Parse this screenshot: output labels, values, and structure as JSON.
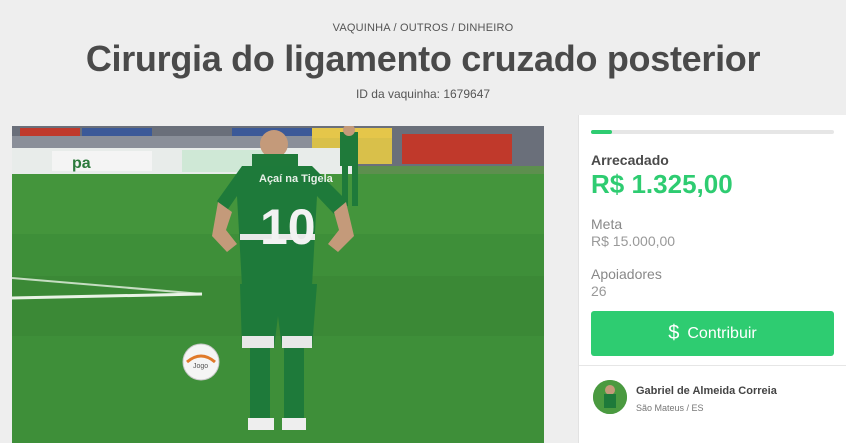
{
  "breadcrumb": "VAQUINHA / OUTROS / DINHEIRO",
  "title": "Cirurgia do ligamento cruzado posterior",
  "campaign_id": "ID da vaquinha: 1679647",
  "photo": {
    "jersey_text": "Açaí na Tigela",
    "jersey_number": "10",
    "ad_board_text": "pa",
    "ball_brand": "Jogo"
  },
  "sidebar": {
    "progress_fraction": 0.088,
    "raised_label": "Arrecadado",
    "raised_value": "R$ 1.325,00",
    "goal_label": "Meta",
    "goal_value": "R$ 15.000,00",
    "supporters_label": "Apoiadores",
    "supporters_value": "26",
    "contribute_icon": "dollar-icon",
    "contribute_label": "Contribuir",
    "owner_name": "Gabriel de Almeida Correia",
    "owner_location": "São Mateus / ES"
  },
  "colors": {
    "accent": "#2ecc71",
    "background": "#eeeeee",
    "title": "#4a4a4a"
  }
}
